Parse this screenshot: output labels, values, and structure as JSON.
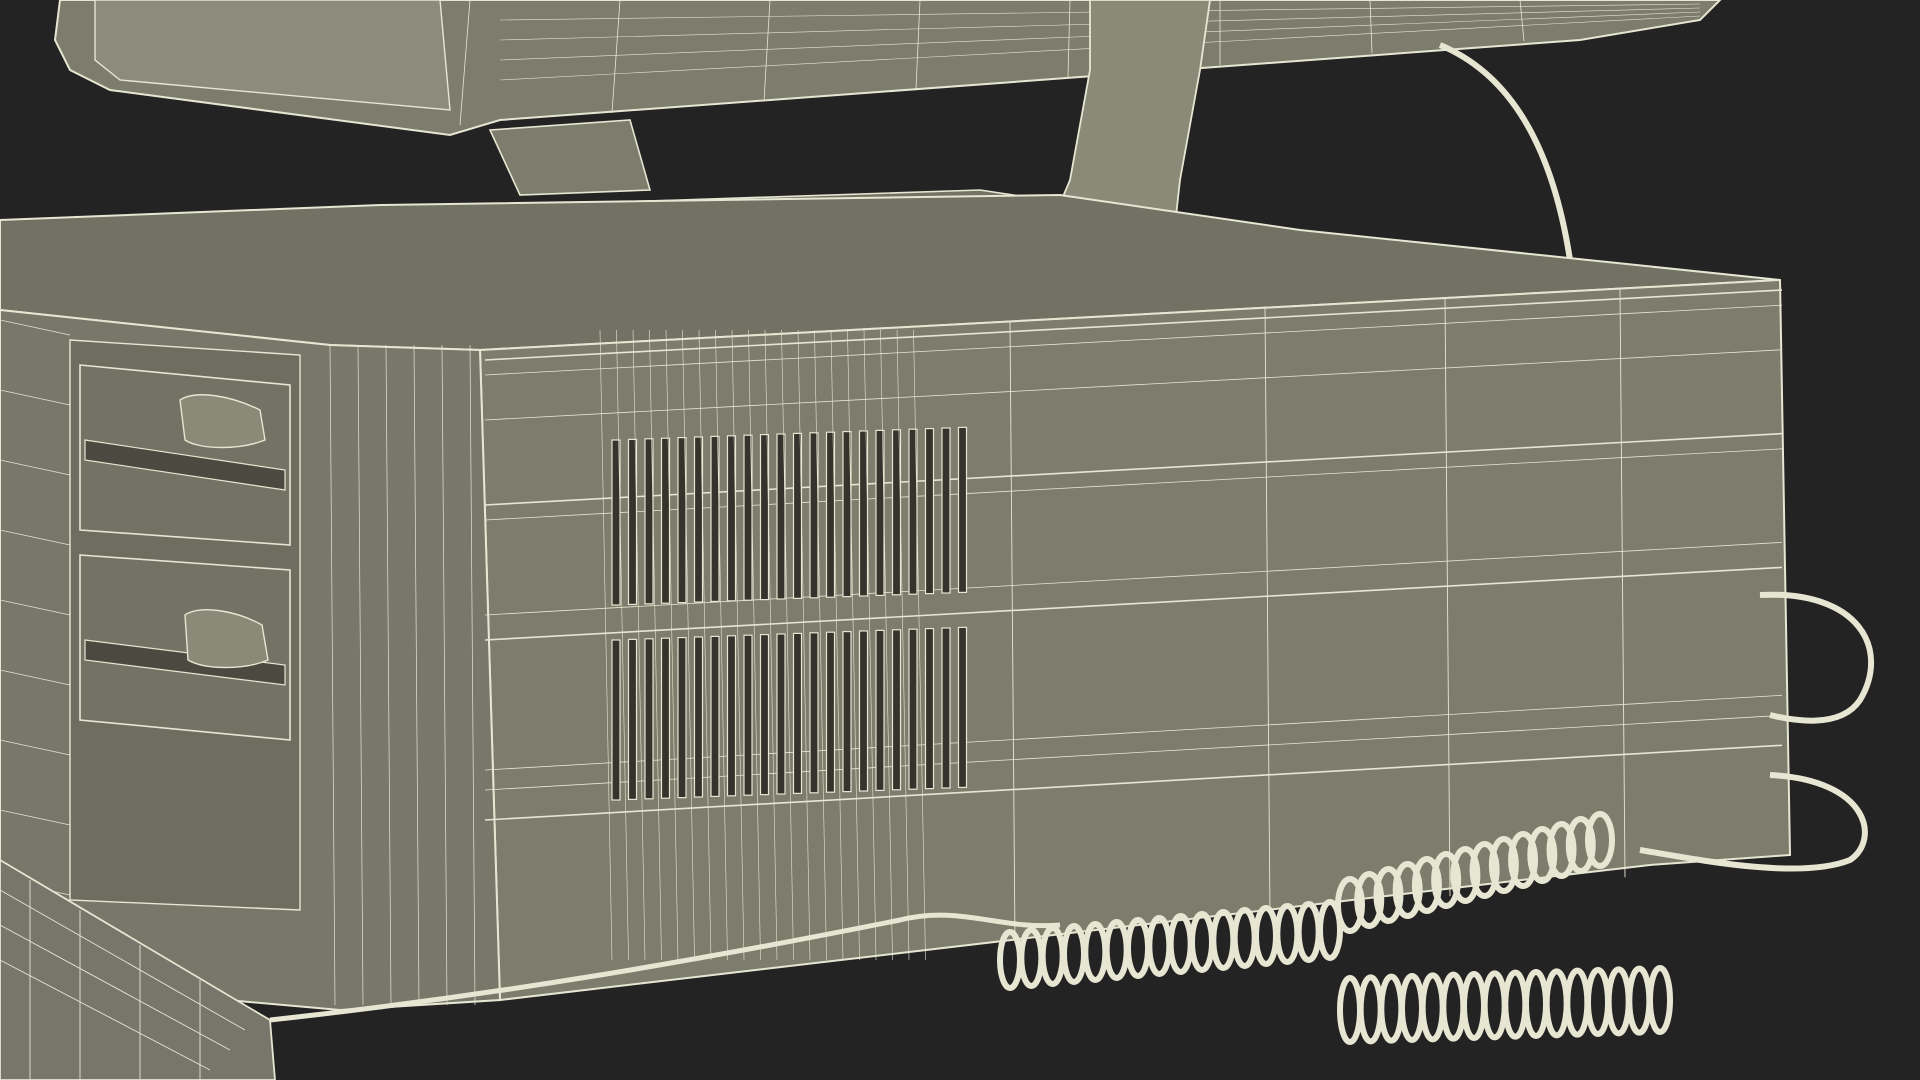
{
  "image": {
    "subject": "wireframe-computer-model",
    "colors": {
      "background": "#232323",
      "surface": "#7d7d6e",
      "surface_dark": "#6a6a5c",
      "surface_light": "#8c8c7c",
      "wire": "#e6e6d2",
      "vent_slot": "#34342c"
    },
    "parts": {
      "monitor": "crt-monitor",
      "stand": "monitor-stand",
      "case": "desktop-case",
      "drive_bays": 2,
      "vent_columns": 22,
      "cable": "coiled-cable",
      "keyboard": "keyboard-corner"
    }
  }
}
